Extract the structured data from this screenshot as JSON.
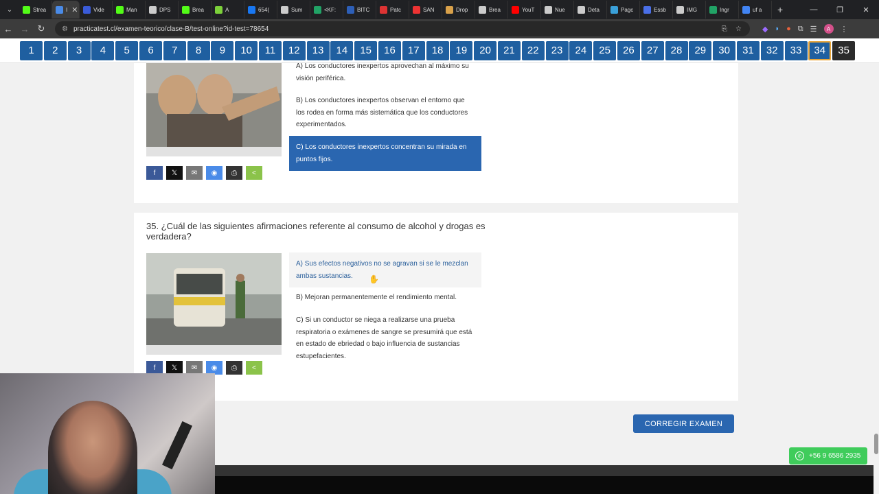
{
  "browser": {
    "tabs": [
      {
        "label": "Strea",
        "color": "#53fc18"
      },
      {
        "label": "I",
        "color": "#4a8be8",
        "active": true
      },
      {
        "label": "Vide",
        "color": "#3a5bd9"
      },
      {
        "label": "Man",
        "color": "#53fc18"
      },
      {
        "label": "DPS",
        "color": "#cccccc"
      },
      {
        "label": "Brea",
        "color": "#53fc18"
      },
      {
        "label": "A",
        "color": "#7cd13a"
      },
      {
        "label": "654(",
        "color": "#1877f2"
      },
      {
        "label": "Sum",
        "color": "#cccccc"
      },
      {
        "label": "<KF:",
        "color": "#21a366"
      },
      {
        "label": "BITC",
        "color": "#2d5fb8"
      },
      {
        "label": "Patc",
        "color": "#d33"
      },
      {
        "label": "SAN",
        "color": "#e33"
      },
      {
        "label": "Drop",
        "color": "#d9a14a"
      },
      {
        "label": "Brea",
        "color": "#cccccc"
      },
      {
        "label": "YouT",
        "color": "#ff0000"
      },
      {
        "label": "Nue",
        "color": "#cccccc"
      },
      {
        "label": "Deta",
        "color": "#cccccc"
      },
      {
        "label": "Pagc",
        "color": "#3aa0d9"
      },
      {
        "label": "Essb",
        "color": "#4a6fe8"
      },
      {
        "label": "IMG",
        "color": "#cccccc"
      },
      {
        "label": "Ingr",
        "color": "#21a366"
      },
      {
        "label": "uf a",
        "color": "#4285f4"
      }
    ],
    "url": "practicatest.cl/examen-teorico/clase-B/test-online?id-test=78654",
    "profile_initial": "A"
  },
  "question_nav": {
    "items": [
      "1",
      "2",
      "3",
      "4",
      "5",
      "6",
      "7",
      "8",
      "9",
      "10",
      "11",
      "12",
      "13",
      "14",
      "15",
      "16",
      "17",
      "18",
      "19",
      "20",
      "21",
      "22",
      "23",
      "24",
      "25",
      "26",
      "27",
      "28",
      "29",
      "30",
      "31",
      "32",
      "33",
      "34",
      "35"
    ],
    "current": "34"
  },
  "q34": {
    "options": [
      "A) Los conductores inexpertos aprovechan al máximo su visión periférica.",
      "B) Los conductores inexpertos observan el entorno que los rodea en forma más sistemática que los conductores experimentados.",
      "C) Los conductores inexpertos concentran su mirada en puntos fijos."
    ],
    "selected_index": 2
  },
  "q35": {
    "title": "35. ¿Cuál de las siguientes afirmaciones referente al consumo de alcohol y drogas es verdadera?",
    "options": [
      "A) Sus efectos negativos no se agravan si se le mezclan ambas sustancias.",
      "B) Mejoran permanentemente el rendimiento mental.",
      "C) Si un conductor se niega a realizarse una prueba respiratoria o exámenes de sangre se presumirá que está en estado de ebriedad o bajo influencia de sustancias estupefacientes."
    ],
    "hover_index": 0
  },
  "share_icons": [
    "facebook-icon",
    "x-icon",
    "email-icon",
    "messenger-icon",
    "print-icon",
    "share-icon"
  ],
  "correct_button": "CORREGIR EXAMEN",
  "whatsapp": "+56 9 6586 2935"
}
